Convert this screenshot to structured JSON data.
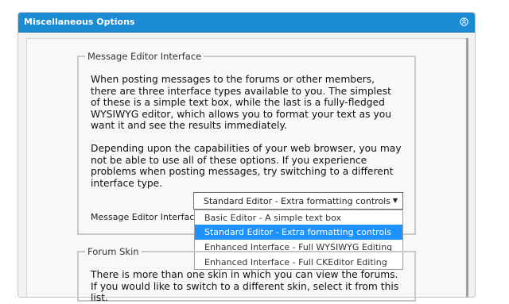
{
  "panel": {
    "title": "Miscellaneous Options",
    "header_color": "#1b8bd4",
    "collapse_icon": "collapse-circle-icon"
  },
  "message_editor": {
    "legend": "Message Editor Interface",
    "paragraph_1": "When posting messages to the forums or other members, there are three interface types available to you. The simplest of these is a simple text box, while the last is a fully-fledged WYSIWYG editor, which allows you to format your text as you want it and see the results immediately.",
    "paragraph_2": "Depending upon the capabilities of your web browser, you may not be able to use all of these options. If you experience problems when posting messages, try switching to a different interface type.",
    "field_label": "Message Editor Interface:",
    "selected_value": "Standard Editor - Extra formatting controls",
    "select_arrow_icon": "dropdown-arrow-icon",
    "options": [
      "Basic Editor - A simple text box",
      "Standard Editor - Extra formatting controls",
      "Enhanced Interface - Full WYSIWYG Editing",
      "Enhanced Interface - Full CKEditor Editing"
    ],
    "highlighted_option_color": "#1e90ff"
  },
  "forum_skin": {
    "legend": "Forum Skin",
    "paragraph": "There is more than one skin in which you can view the forums. If you would like to switch to a different skin, select it from this list."
  }
}
